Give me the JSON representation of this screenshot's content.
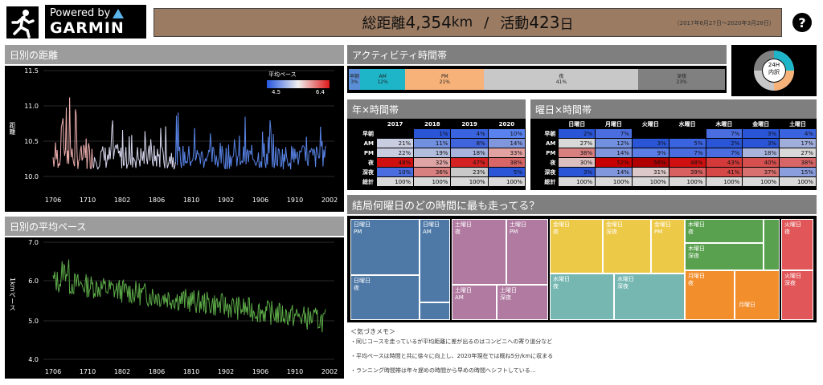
{
  "logo": {
    "powered_by": "Powered by",
    "brand": "GARMIN"
  },
  "banner": {
    "total_label": "総距離",
    "total_value": "4,354",
    "total_unit": "km",
    "sep": "/",
    "days_label": "活動",
    "days_value": "423",
    "days_unit": "日",
    "period": "（2017年6月27日～2020年3月28日）"
  },
  "help": {
    "label": "?"
  },
  "distance_panel": {
    "title": "日別の距離",
    "ylabel": "距離",
    "legend_title": "平均ペース",
    "legend_min": "4.5",
    "legend_max": "6.4",
    "yticks": [
      "11.5",
      "11.0",
      "10.5",
      "10.0"
    ],
    "xticks": [
      "1706",
      "1710",
      "1802",
      "1806",
      "1810",
      "1902",
      "1906",
      "1910",
      "2002"
    ]
  },
  "pace_panel": {
    "title": "日別の平均ペース",
    "ylabel": "1kmペース",
    "yticks": [
      "7.0",
      "6.0",
      "5.0",
      "4.0"
    ],
    "xticks": [
      "1706",
      "1710",
      "1802",
      "1806",
      "1810",
      "1902",
      "1906",
      "1910",
      "2002"
    ]
  },
  "activity": {
    "title": "アクティビティ時間帯",
    "segments": [
      {
        "name": "早朝",
        "pct": "3%",
        "color": "#5a8fd8"
      },
      {
        "name": "AM",
        "pct": "12%",
        "color": "#1fb5c9"
      },
      {
        "name": "PM",
        "pct": "21%",
        "color": "#f7b27a"
      },
      {
        "name": "夜",
        "pct": "41%",
        "color": "#c8c8c8"
      },
      {
        "name": "深夜",
        "pct": "23%",
        "color": "#808080"
      }
    ],
    "donut_label_top": "24H",
    "donut_label_bottom": "内訳"
  },
  "year_table": {
    "title": "年×時間帯",
    "cols": [
      "2017",
      "2018",
      "2019",
      "2020"
    ],
    "rows": [
      {
        "label": "早朝",
        "cells": [
          {
            "v": "",
            "c": "#000000"
          },
          {
            "v": "1%",
            "c": "#2a55d6"
          },
          {
            "v": "4%",
            "c": "#3a63e0"
          },
          {
            "v": "10%",
            "c": "#5a82ee"
          }
        ]
      },
      {
        "label": "AM",
        "cells": [
          {
            "v": "21%",
            "c": "#c9cde0"
          },
          {
            "v": "11%",
            "c": "#7290e0"
          },
          {
            "v": "8%",
            "c": "#3f64db"
          },
          {
            "v": "14%",
            "c": "#8096dd"
          }
        ]
      },
      {
        "label": "PM",
        "cells": [
          {
            "v": "22%",
            "c": "#c9cde0"
          },
          {
            "v": "19%",
            "c": "#b2bcdd"
          },
          {
            "v": "18%",
            "c": "#a8b4dc"
          },
          {
            "v": "33%",
            "c": "#e2a2a2"
          }
        ]
      },
      {
        "label": "夜",
        "cells": [
          {
            "v": "48%",
            "c": "#d01010"
          },
          {
            "v": "32%",
            "c": "#dfa4a4"
          },
          {
            "v": "47%",
            "c": "#d42222"
          },
          {
            "v": "38%",
            "c": "#d86666"
          }
        ]
      },
      {
        "label": "深夜",
        "cells": [
          {
            "v": "10%",
            "c": "#4a6ee0"
          },
          {
            "v": "36%",
            "c": "#d88080"
          },
          {
            "v": "23%",
            "c": "#c9c9c9"
          },
          {
            "v": "5%",
            "c": "#2a55d6"
          }
        ]
      },
      {
        "label": "総計",
        "cells": [
          {
            "v": "100%",
            "c": "#d9d9d9"
          },
          {
            "v": "100%",
            "c": "#d9d9d9"
          },
          {
            "v": "100%",
            "c": "#d9d9d9"
          },
          {
            "v": "100%",
            "c": "#d9d9d9"
          }
        ],
        "total": true
      }
    ]
  },
  "weekday_table": {
    "title": "曜日×時間帯",
    "cols": [
      "日曜日",
      "月曜日",
      "火曜日",
      "水曜日",
      "木曜日",
      "金曜日",
      "土曜日"
    ],
    "rows": [
      {
        "label": "早朝",
        "cells": [
          {
            "v": "2%",
            "c": "#2a55d6"
          },
          {
            "v": "7%",
            "c": "#4a6ee0"
          },
          {
            "v": "",
            "c": "#000000"
          },
          {
            "v": "",
            "c": "#000000"
          },
          {
            "v": "7%",
            "c": "#4a6ee0"
          },
          {
            "v": "3%",
            "c": "#2a55d6"
          },
          {
            "v": "4%",
            "c": "#3a63e0"
          }
        ]
      },
      {
        "label": "AM",
        "cells": [
          {
            "v": "27%",
            "c": "#d8d8d8"
          },
          {
            "v": "12%",
            "c": "#7290e0"
          },
          {
            "v": "3%",
            "c": "#2a55d6"
          },
          {
            "v": "5%",
            "c": "#3a63e0"
          },
          {
            "v": "2%",
            "c": "#2a55d6"
          },
          {
            "v": "3%",
            "c": "#2a55d6"
          },
          {
            "v": "17%",
            "c": "#a0aedc"
          }
        ]
      },
      {
        "label": "PM",
        "cells": [
          {
            "v": "38%",
            "c": "#d88080"
          },
          {
            "v": "14%",
            "c": "#8096dd"
          },
          {
            "v": "9%",
            "c": "#5a7ee6"
          },
          {
            "v": "7%",
            "c": "#4a6ee0"
          },
          {
            "v": "7%",
            "c": "#4a6ee0"
          },
          {
            "v": "18%",
            "c": "#a8b4dc"
          },
          {
            "v": "27%",
            "c": "#d8d8d8"
          }
        ]
      },
      {
        "label": "夜",
        "cells": [
          {
            "v": "30%",
            "c": "#dcc0c0"
          },
          {
            "v": "52%",
            "c": "#c80000"
          },
          {
            "v": "56%",
            "c": "#b00000"
          },
          {
            "v": "48%",
            "c": "#d01010"
          },
          {
            "v": "43%",
            "c": "#d43a3a"
          },
          {
            "v": "40%",
            "c": "#d65050"
          },
          {
            "v": "38%",
            "c": "#d86666"
          }
        ]
      },
      {
        "label": "深夜",
        "cells": [
          {
            "v": "3%",
            "c": "#2a55d6"
          },
          {
            "v": "14%",
            "c": "#8096dd"
          },
          {
            "v": "31%",
            "c": "#dcc8c8"
          },
          {
            "v": "39%",
            "c": "#d86060"
          },
          {
            "v": "41%",
            "c": "#d64848"
          },
          {
            "v": "37%",
            "c": "#d87070"
          },
          {
            "v": "15%",
            "c": "#8a9ede"
          }
        ]
      },
      {
        "label": "総計",
        "cells": [
          {
            "v": "100%",
            "c": "#d9d9d9"
          },
          {
            "v": "100%",
            "c": "#d9d9d9"
          },
          {
            "v": "100%",
            "c": "#d9d9d9"
          },
          {
            "v": "100%",
            "c": "#d9d9d9"
          },
          {
            "v": "100%",
            "c": "#d9d9d9"
          },
          {
            "v": "100%",
            "c": "#d9d9d9"
          },
          {
            "v": "100%",
            "c": "#d9d9d9"
          }
        ],
        "total": true
      }
    ]
  },
  "treemap": {
    "title": "結局何曜日のどの時間に最も走ってる？",
    "labels": {
      "sun_pm": "日曜日\nPM",
      "sun_am": "日曜日\nAM",
      "sun_night": "日曜日\n夜",
      "sat_night": "土曜日\n夜",
      "sat_pm": "土曜日\nPM",
      "sat_am": "土曜日\nAM",
      "sat_late": "土曜日\n深夜",
      "fri_night": "金曜日\n夜",
      "fri_late": "金曜日\n深夜",
      "fri_pm": "金曜日\nPM",
      "wed_night": "水曜日\n夜",
      "wed_late": "水曜日\n深夜",
      "thu_night": "木曜日\n夜",
      "thu_late": "木曜日\n深夜",
      "mon_night": "月曜日\n夜",
      "mon_small": "月曜日",
      "tue_night": "火曜日\n夜",
      "tue_late": "火曜日\n深夜"
    }
  },
  "memo": {
    "title": "＜気づきメモ＞",
    "lines": [
      "・同じコースを走っているが平均距離に差が出るのはコンビニへの寄り道分など",
      "・平均ペースは時間と共に徐々に向上し、2020年現在では概ね5分/kmに収まる",
      "・ランニング時間帯は年々遅めの時間から早めの時間へシフトしている…"
    ]
  },
  "colors": {
    "accent": "#9b7b62",
    "panel": "#000000",
    "header": "#9c9c9c",
    "pace_line": "#5caa48"
  }
}
